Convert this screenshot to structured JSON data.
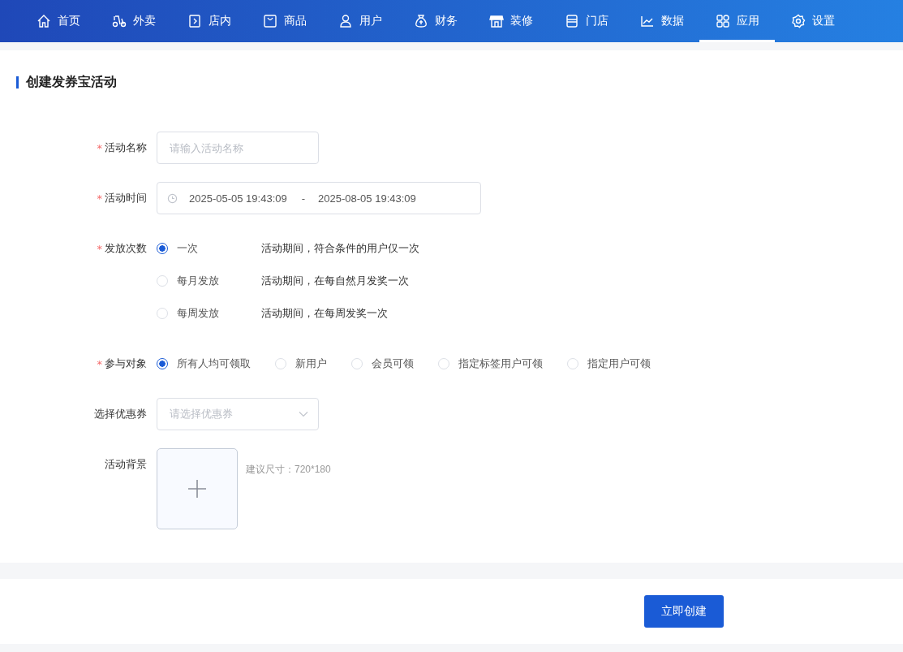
{
  "nav": [
    {
      "label": "首页",
      "selected": false
    },
    {
      "label": "外卖",
      "selected": false
    },
    {
      "label": "店内",
      "selected": false
    },
    {
      "label": "商品",
      "selected": false
    },
    {
      "label": "用户",
      "selected": false
    },
    {
      "label": "财务",
      "selected": false
    },
    {
      "label": "装修",
      "selected": false
    },
    {
      "label": "门店",
      "selected": false
    },
    {
      "label": "数据",
      "selected": false
    },
    {
      "label": "应用",
      "selected": true
    },
    {
      "label": "设置",
      "selected": false
    }
  ],
  "page_title": "创建发券宝活动",
  "required_mark": "*",
  "form": {
    "name": {
      "label": "活动名称",
      "required": true,
      "placeholder": "请输入活动名称"
    },
    "time": {
      "label": "活动时间",
      "required": true,
      "start": "2025-05-05 19:43:09",
      "separator": "-",
      "end": "2025-08-05 19:43:09"
    },
    "frequency": {
      "label": "发放次数",
      "required": true,
      "options": [
        {
          "label": "一次",
          "description": "活动期间，符合条件的用户仅一次",
          "selected": true
        },
        {
          "label": "每月发放",
          "description": "活动期间，在每自然月发奖一次",
          "selected": false
        },
        {
          "label": "每周发放",
          "description": "活动期间，在每周发奖一次",
          "selected": false
        }
      ]
    },
    "audience": {
      "label": "参与对象",
      "required": true,
      "options": [
        {
          "label": "所有人均可领取",
          "selected": true
        },
        {
          "label": "新用户",
          "selected": false
        },
        {
          "label": "会员可领",
          "selected": false
        },
        {
          "label": "指定标签用户可领",
          "selected": false
        },
        {
          "label": "指定用户可领",
          "selected": false
        }
      ]
    },
    "coupon": {
      "label": "选择优惠券",
      "required": false,
      "placeholder": "请选择优惠券"
    },
    "background": {
      "label": "活动背景",
      "required": false,
      "hint": "建议尺寸：720*180"
    }
  },
  "submit": "立即创建"
}
